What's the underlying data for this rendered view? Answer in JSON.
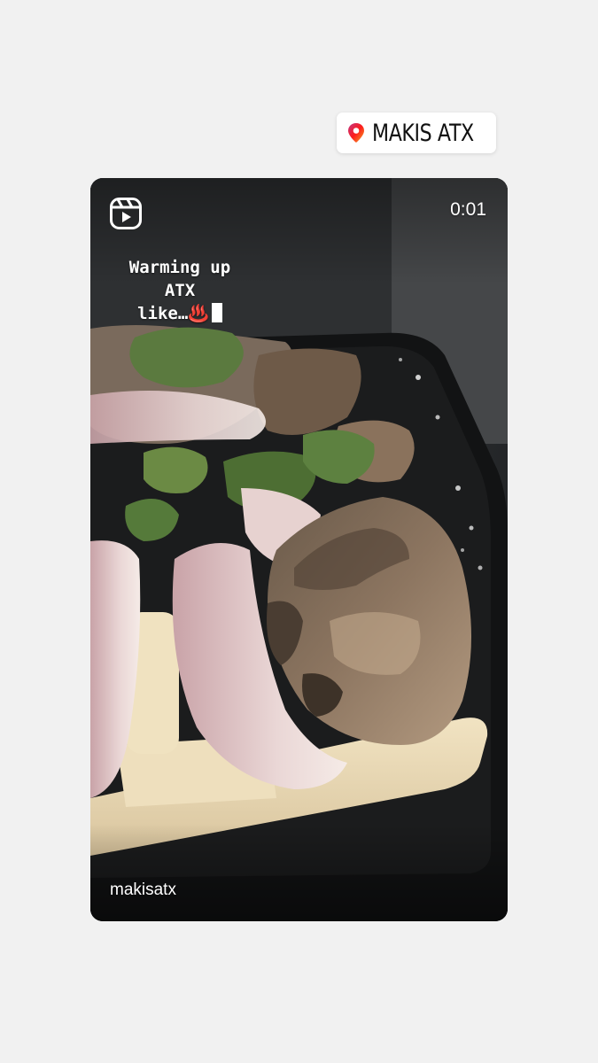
{
  "location_sticker": {
    "label": "MAKIS ATX",
    "icon": "location-pin-icon"
  },
  "reel": {
    "duration": "0:01",
    "caption_lines": [
      "Warming up",
      "ATX",
      "like…♨️"
    ],
    "username": "makisatx",
    "icon": "reels-icon"
  },
  "colors": {
    "background": "#f1f1f1",
    "pin_gradient_start": "#ff2d7a",
    "pin_gradient_end": "#f5a623"
  }
}
